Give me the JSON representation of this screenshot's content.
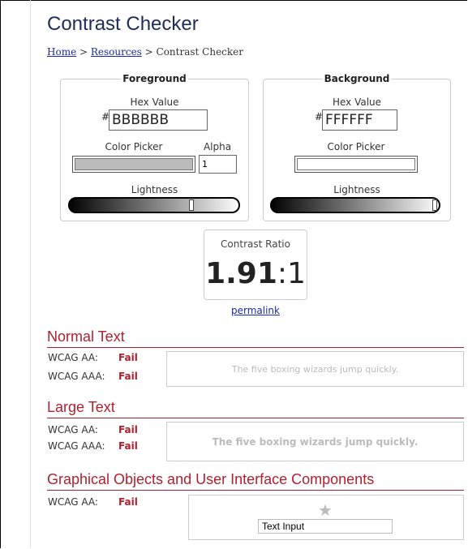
{
  "page": {
    "title": "Contrast Checker",
    "breadcrumb": {
      "home": "Home",
      "sep1": " > ",
      "resources": "Resources",
      "sep2": " > ",
      "current": "Contrast Checker"
    }
  },
  "foreground": {
    "legend": "Foreground",
    "hex_label": "Hex Value",
    "hash": "#",
    "hex_value": "BBBBBB",
    "picker_label": "Color Picker",
    "alpha_label": "Alpha",
    "alpha_value": "1",
    "lightness_label": "Lightness",
    "color": "#bbbbbb",
    "lightness": 0.73
  },
  "background": {
    "legend": "Background",
    "hex_label": "Hex Value",
    "hash": "#",
    "hex_value": "FFFFFF",
    "picker_label": "Color Picker",
    "lightness_label": "Lightness",
    "color": "#ffffff",
    "lightness": 1.0
  },
  "contrast": {
    "label": "Contrast Ratio",
    "value": "1.91",
    "suffix": ":1",
    "permalink": "permalink"
  },
  "normal_text": {
    "heading": "Normal Text",
    "aa_label": "WCAG AA:",
    "aa_result": "Fail",
    "aaa_label": "WCAG AAA:",
    "aaa_result": "Fail",
    "sample": "The five boxing wizards jump quickly."
  },
  "large_text": {
    "heading": "Large Text",
    "aa_label": "WCAG AA:",
    "aa_result": "Fail",
    "aaa_label": "WCAG AAA:",
    "aaa_result": "Fail",
    "sample": "The five boxing wizards jump quickly."
  },
  "graphical": {
    "heading": "Graphical Objects and User Interface Components",
    "aa_label": "WCAG AA:",
    "aa_result": "Fail",
    "input_value": "Text Input",
    "icon": "star-icon"
  },
  "colors": {
    "accent_red": "#b2202f",
    "title_navy": "#1f2c5a",
    "link_blue": "#1a2ba6"
  }
}
